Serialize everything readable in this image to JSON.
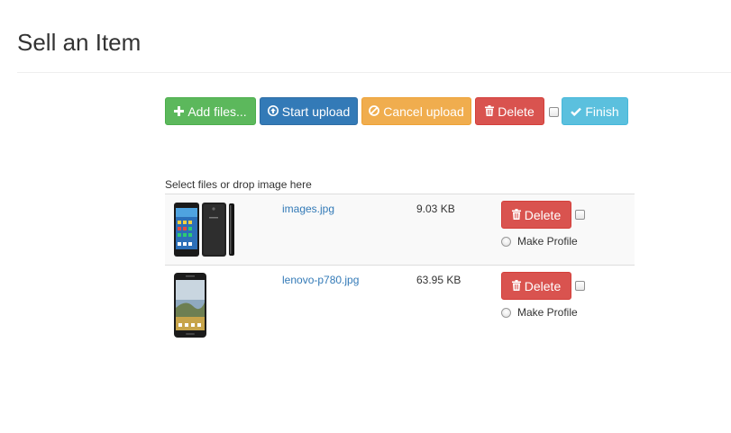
{
  "page": {
    "title": "Sell an Item"
  },
  "toolbar": {
    "add_files": "Add files...",
    "start_upload": "Start upload",
    "cancel_upload": "Cancel upload",
    "delete": "Delete",
    "finish": "Finish"
  },
  "upload": {
    "drop_label": "Select files or drop image here",
    "files": [
      {
        "name": "images.jpg",
        "size": "9.03 KB",
        "delete_label": "Delete",
        "profile_label": "Make Profile"
      },
      {
        "name": "lenovo-p780.jpg",
        "size": "63.95 KB",
        "delete_label": "Delete",
        "profile_label": "Make Profile"
      }
    ]
  },
  "colors": {
    "success": "#5cb85c",
    "primary": "#337ab7",
    "warning": "#f0ad4e",
    "danger": "#d9534f",
    "info": "#5bc0de",
    "link": "#337ab7"
  },
  "icons": {
    "add_files": "plus-icon",
    "start_upload": "upload-circle-icon",
    "cancel_upload": "ban-icon",
    "delete": "trash-icon",
    "finish": "check-icon"
  }
}
